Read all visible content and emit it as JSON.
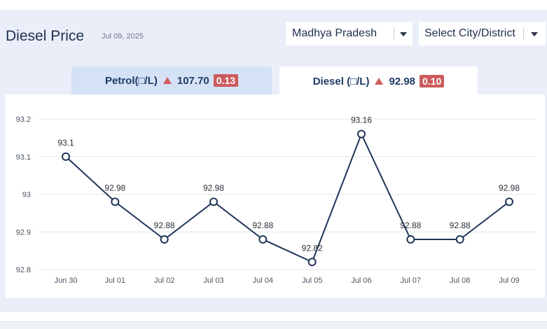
{
  "header": {
    "title": "Diesel Price",
    "date": "Jul 09, 2025"
  },
  "filters": {
    "state": "Madhya Pradesh",
    "city": "Select City/District"
  },
  "tabs": [
    {
      "label": "Petrol(□/L)",
      "price": "107.70",
      "change": "0.13",
      "selected": false
    },
    {
      "label": "Diesel (□/L)",
      "price": "92.98",
      "change": "0.10",
      "selected": true
    }
  ],
  "colors": {
    "line": "#1f3557",
    "up_indicator": "#d25d5d",
    "selected_tab_bg": "#ffffff",
    "unselected_tab_bg": "#d5e1f5"
  },
  "chart_data": {
    "type": "line",
    "categories": [
      "Jun 30",
      "Jul 01",
      "Jul 02",
      "Jul 03",
      "Jul 04",
      "Jul 05",
      "Jul 06",
      "Jul 07",
      "Jul 08",
      "Jul 09"
    ],
    "series": [
      {
        "values": [
          93.1,
          92.98,
          92.88,
          92.98,
          92.88,
          92.82,
          93.16,
          92.88,
          92.88,
          92.98
        ]
      }
    ],
    "data_labels": [
      "93.1",
      "92.98",
      "92.88",
      "92.98",
      "92.88",
      "92.82",
      "93.16",
      "92.88",
      "92.88",
      "92.98"
    ],
    "y_ticks": [
      "92.8",
      "92.9",
      "93",
      "93.1",
      "93.2"
    ],
    "ylim": [
      92.8,
      93.2
    ],
    "grid": true
  }
}
